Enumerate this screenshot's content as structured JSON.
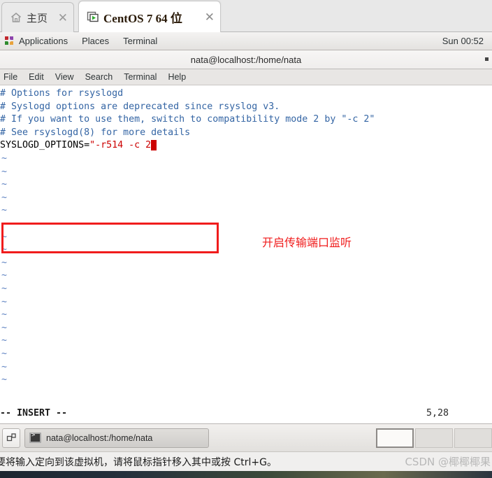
{
  "vmware": {
    "tabs": [
      {
        "label": "主页",
        "icon": "home-icon",
        "close": "✕",
        "active": false
      },
      {
        "label": "CentOS 7 64 位",
        "icon": "vm-powered-on-icon",
        "close": "✕",
        "active": true
      }
    ],
    "status_message": "要将输入定向到该虚拟机，请将鼠标指针移入其中或按 Ctrl+G。",
    "watermark": "CSDN @椰椰椰果"
  },
  "gnome_panel": {
    "applications": "Applications",
    "places": "Places",
    "terminal": "Terminal",
    "clock": "Sun 00:52",
    "apps_icon": "app-grid-icon"
  },
  "terminal": {
    "title": "nata@localhost:/home/nata",
    "menu": [
      "File",
      "Edit",
      "View",
      "Search",
      "Terminal",
      "Help"
    ],
    "lines": [
      "# Options for rsyslogd",
      "# Syslogd options are deprecated since rsyslog v3.",
      "# If you want to use them, switch to compatibility mode 2 by \"-c 2\"",
      "# See rsyslogd(8) for more details"
    ],
    "edited_line": {
      "prefix": "SYSLOGD_OPTIONS=",
      "quote_open": "\"",
      "value": "-r514 -c 2",
      "quote_close": "\""
    },
    "tilde": "~",
    "tilde_count": 18,
    "status_mode": "-- INSERT --",
    "status_pos": "5,28",
    "colors": {
      "comment": "#3465a4",
      "string": "#cc0000",
      "highlight_box": "#f01c1c",
      "cursor": "#cc0000",
      "background": "#ffffff"
    }
  },
  "annotation": {
    "text": "开启传输端口监听",
    "color": "#f01c1c"
  },
  "taskbar": {
    "show_desktop_icon": "show-desktop-icon",
    "window_button": {
      "icon": "terminal-icon",
      "label": "nata@localhost:/home/nata"
    },
    "workspaces": [
      {
        "index": 1,
        "active": true
      },
      {
        "index": 2,
        "active": false
      },
      {
        "index": 3,
        "active": false
      }
    ]
  }
}
